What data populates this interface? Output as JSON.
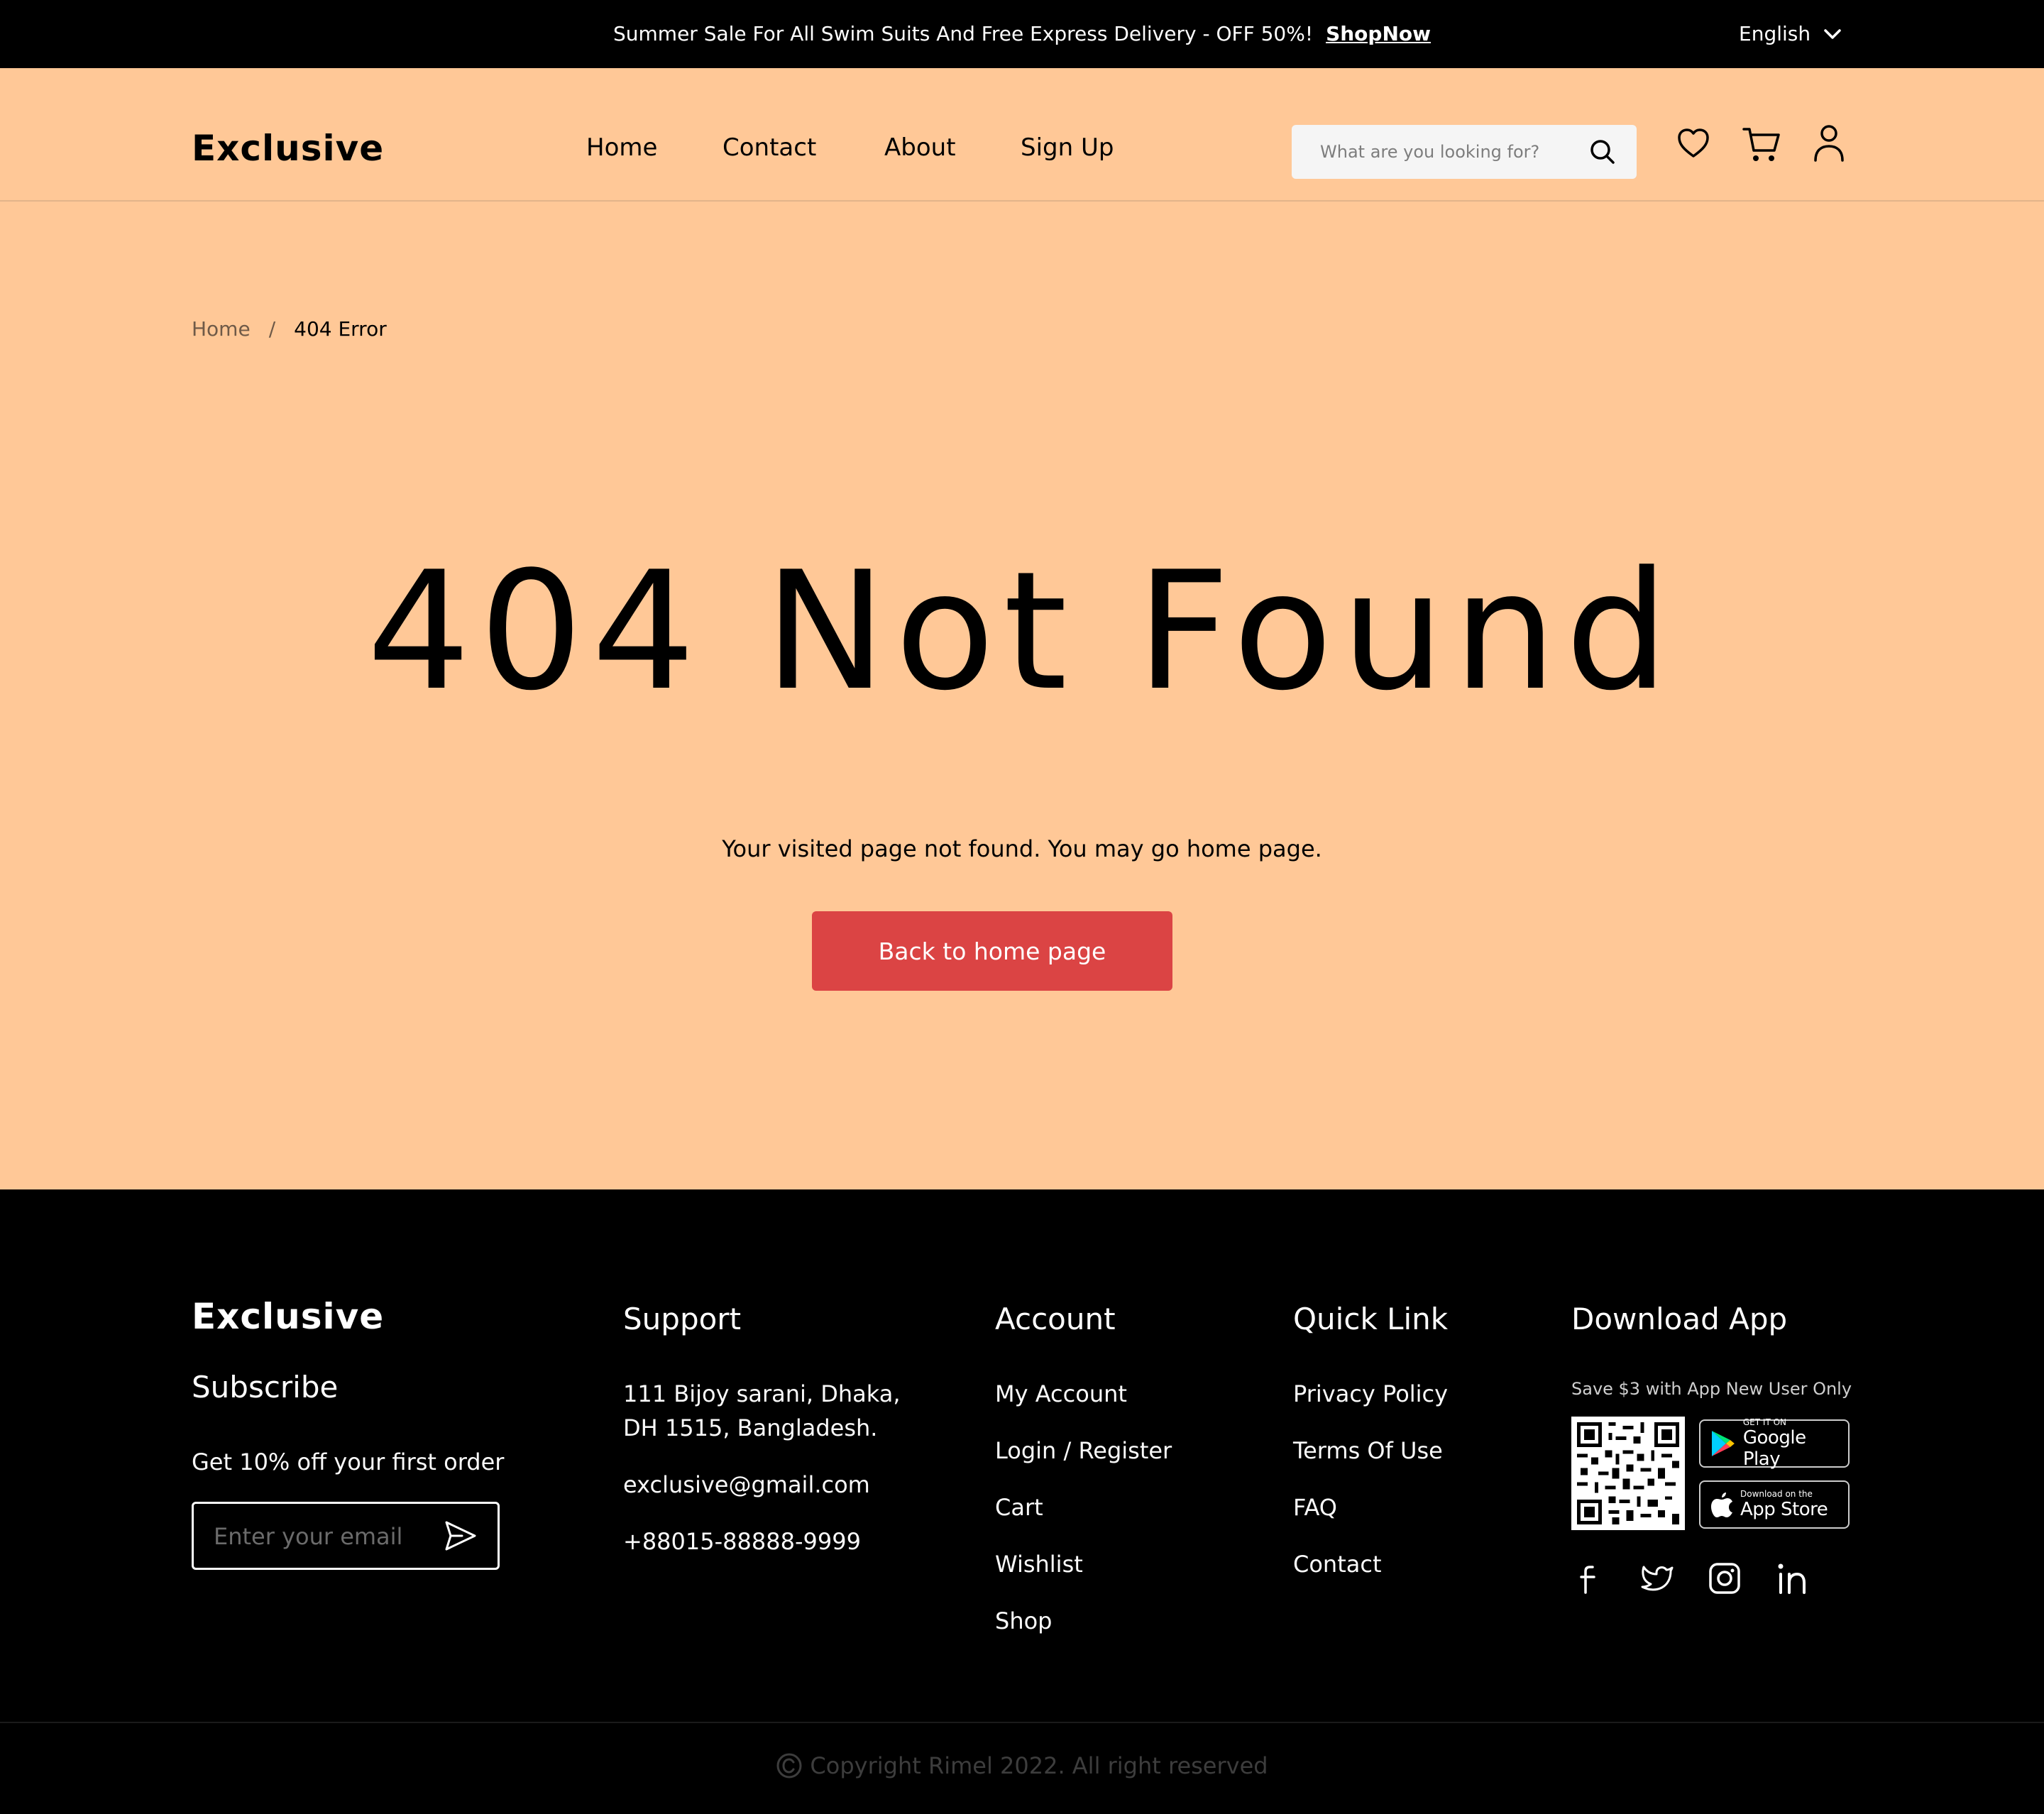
{
  "topbar": {
    "promo": "Summer Sale For All Swim Suits And Free Express Delivery - OFF 50%!",
    "shop_now": "ShopNow",
    "language": "English"
  },
  "header": {
    "logo": "Exclusive",
    "nav": [
      "Home",
      "Contact",
      "About",
      "Sign Up"
    ],
    "search_placeholder": "What are you looking for?",
    "icons": [
      "search-icon",
      "heart-icon",
      "cart-icon",
      "user-icon"
    ]
  },
  "breadcrumb": {
    "home": "Home",
    "separator": "/",
    "current": "404 Error"
  },
  "error": {
    "title": "404 Not Found",
    "message": "Your visited page not found. You may go home page.",
    "button": "Back to home page"
  },
  "footer": {
    "brand": {
      "logo": "Exclusive",
      "subscribe": "Subscribe",
      "offer": "Get 10% off your first order",
      "email_placeholder": "Enter your email"
    },
    "support": {
      "heading": "Support",
      "address_line1": "111 Bijoy sarani, Dhaka,",
      "address_line2": "DH 1515, Bangladesh.",
      "email": "exclusive@gmail.com",
      "phone": "+88015-88888-9999"
    },
    "account": {
      "heading": "Account",
      "items": [
        "My Account",
        "Login / Register",
        "Cart",
        "Wishlist",
        "Shop"
      ]
    },
    "quick_link": {
      "heading": "Quick Link",
      "items": [
        "Privacy Policy",
        "Terms Of Use",
        "FAQ",
        "Contact"
      ]
    },
    "download": {
      "heading": "Download App",
      "note": "Save $3 with App New User Only",
      "google_small": "GET IT ON",
      "google_big": "Google Play",
      "apple_small": "Download on the",
      "apple_big": "App Store"
    },
    "social_icons": [
      "facebook-icon",
      "twitter-icon",
      "instagram-icon",
      "linkedin-icon"
    ],
    "copyright": "Copyright Rimel 2022. All right reserved"
  },
  "colors": {
    "page_background": "#ffc897",
    "accent_button": "#db4444",
    "topbar": "#000000",
    "footer": "#000000"
  }
}
